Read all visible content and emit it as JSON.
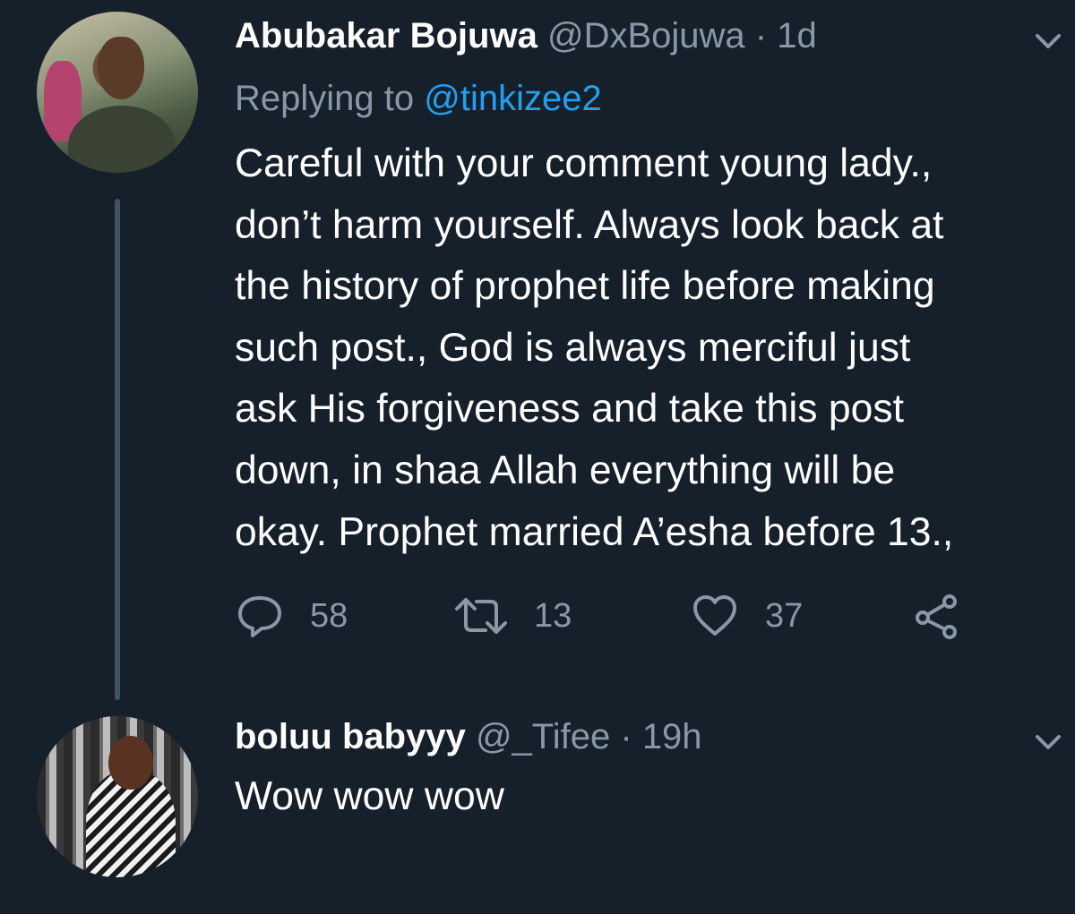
{
  "tweets": [
    {
      "name": "Abubakar Bojuwa",
      "handle": "@DxBojuwa",
      "separator": "·",
      "time": "1d",
      "replying_prefix": "Replying to",
      "replying_to": "@tinkizee2",
      "text": "Careful with your comment young lady.,\ndon’t harm yourself. Always look back at\nthe history of prophet life before making\nsuch post., God is always merciful just\nask His forgiveness and take this post\ndown, in shaa Allah everything will be\nokay. Prophet married A’esha before 13.,",
      "actions": {
        "replies": "58",
        "retweets": "13",
        "likes": "37"
      }
    },
    {
      "name": "boluu babyyy",
      "handle": "@_Tifee",
      "separator": "·",
      "time": "19h",
      "text": "Wow wow wow"
    }
  ],
  "icons": {
    "reply": "reply-icon",
    "retweet": "retweet-icon",
    "like": "heart-icon",
    "share": "share-icon",
    "menu": "chevron-down-icon"
  },
  "colors": {
    "background": "#15202b",
    "primary_text": "#ffffff",
    "secondary_text": "#8899a6",
    "link": "#1da1f2",
    "thread_line": "#3d5466"
  }
}
